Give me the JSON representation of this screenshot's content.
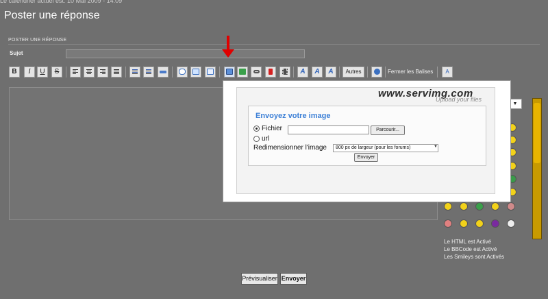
{
  "page": {
    "top_strip_text": "Le calendrier actuel est: 10 Mai 2009 - 14:09",
    "title": "Poster une réponse"
  },
  "form": {
    "header": "POSTER UNE RÉPONSE",
    "subject_label": "Sujet",
    "subject_value": ""
  },
  "toolbar": {
    "bold": "B",
    "italic": "I",
    "underline": "U",
    "strike": "S",
    "autres": "Autres",
    "fermer_balises": "Fermer les Balises",
    "font_size_icon": "A"
  },
  "upload_popup": {
    "logo": "www.servimg.com",
    "tagline": "Upload your files",
    "form_title": "Envoyez votre image",
    "file_label": "Fichier",
    "file_value": "",
    "browse_label": "Parcourir...",
    "url_label": "url",
    "resize_label": "Redimensionner l'image",
    "resize_selected": "800 px de largeur (pour les forums)",
    "send_label": "Envoyer"
  },
  "status": {
    "html": "Le HTML est Activé",
    "bbcode": "Le BBCode est Activé",
    "smileys": "Les Smileys sont Activés"
  },
  "actions": {
    "preview": "Prévisualiser",
    "send": "Envoyer"
  },
  "colors": {
    "background": "#6f6f6f",
    "arrow": "#e00000",
    "popup_title": "#3b7fd6",
    "scrollbar": "#c89a00"
  }
}
